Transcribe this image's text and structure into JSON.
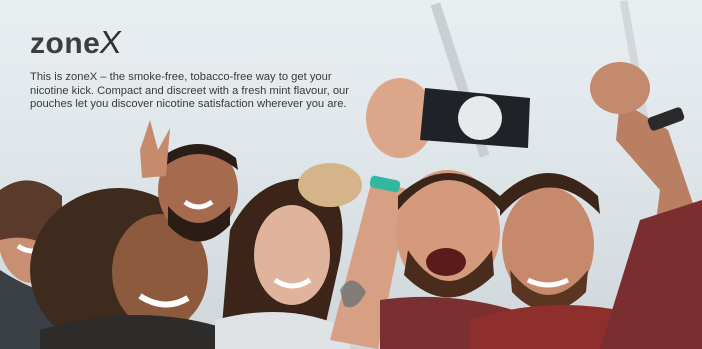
{
  "brand": {
    "logo_text": "zone",
    "logo_mark": "X",
    "tagline": "This is zoneX – the smoke-free, tobacco-free way to get your nicotine kick. Compact and discreet with a fresh mint flavour, our pouches let you discover nicotine satisfaction wherever you are."
  },
  "colors": {
    "text": "#3a3a3a",
    "sky": "#e4eaee"
  }
}
